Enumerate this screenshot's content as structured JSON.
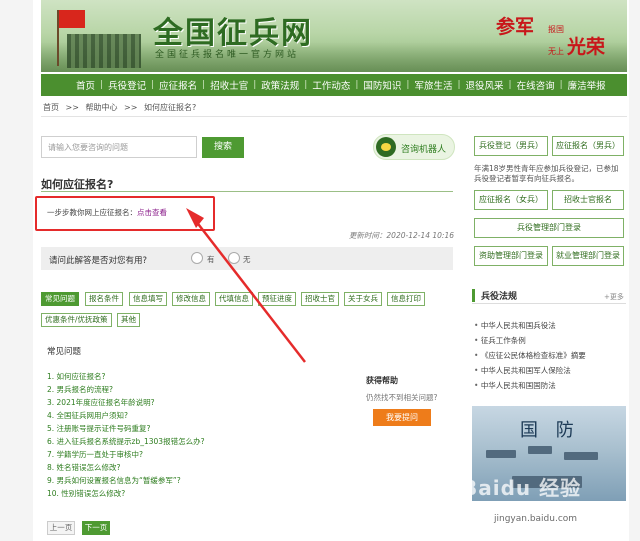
{
  "header": {
    "site_title": "全国征兵网",
    "site_subtitle": "全国征兵报名唯一官方网站",
    "slogan": {
      "part1": "参军",
      "part2": "报国",
      "part3": "无上",
      "part4": "光荣"
    }
  },
  "nav": {
    "items": [
      "首页",
      "兵役登记",
      "应征报名",
      "招收士官",
      "政策法规",
      "工作动态",
      "国防知识",
      "军旅生活",
      "退役风采",
      "在线咨询",
      "廉洁举报"
    ]
  },
  "breadcrumb": [
    "首页",
    ">>",
    "帮助中心",
    ">>",
    "如何应征报名?"
  ],
  "search": {
    "placeholder": "请输入您要咨询的问题",
    "button": "搜索"
  },
  "robot": {
    "label": "咨询机器人"
  },
  "question": {
    "title": "如何应征报名?",
    "answer_text": "一步步教你网上应征报名：",
    "answer_link": "点击查看",
    "update_time": "更新时间：2020-12-14 10:16"
  },
  "helpful": {
    "question": "请问此解答是否对您有用?",
    "yes": "有",
    "no": "无"
  },
  "tags": [
    "常见问题",
    "报名条件",
    "信息填写",
    "修改信息",
    "代填信息",
    "预征进度",
    "招收士官",
    "关于女兵",
    "信息打印",
    "优惠条件/优抚政策",
    "其他"
  ],
  "common": {
    "title": "常见问题",
    "items": [
      "1. 如何应征报名?",
      "2. 男兵报名的流程?",
      "3. 2021年度应征报名年龄说明?",
      "4. 全国征兵网用户须知?",
      "5. 注册账号提示证件号码重复?",
      "6. 进入征兵报名系统提示zb_1303报错怎么办?",
      "7. 学籍学历一直处于审核中?",
      "8. 姓名错误怎么修改?",
      "9. 男兵如何设置报名信息为“暂缓参军”?",
      "10. 性别错误怎么修改?"
    ],
    "help_title": "获得帮助",
    "help_sub": "仍然找不到相关问题?",
    "help_button": "我要提问",
    "prev": "上一页",
    "next": "下一页"
  },
  "sidebar": {
    "buttons": [
      "兵役登记（男兵）",
      "应征报名（男兵）",
      "应征报名（女兵）",
      "招收士官报名",
      "兵役管理部门登录",
      "资助管理部门登录",
      "就业管理部门登录"
    ],
    "note": "年满18岁男性青年应参加兵役登记，已参加兵役登记者暂享有向征兵报名。",
    "law_title": "兵役法规",
    "law_more": "+更多",
    "laws": [
      "中华人民共和国兵役法",
      "征兵工作条例",
      "《应征公民体格检查标准》摘要",
      "中华人民共和国军人保险法",
      "中华人民共和国国防法"
    ],
    "photo_text": "国 防"
  },
  "watermark": {
    "text": "Baidu 经验",
    "sub": "jingyan.baidu.com"
  },
  "colors": {
    "brand_green": "#4e9a32",
    "nav_green": "#4b8f2f",
    "highlight_red": "#e52b2b",
    "help_orange": "#ee7c1a"
  }
}
